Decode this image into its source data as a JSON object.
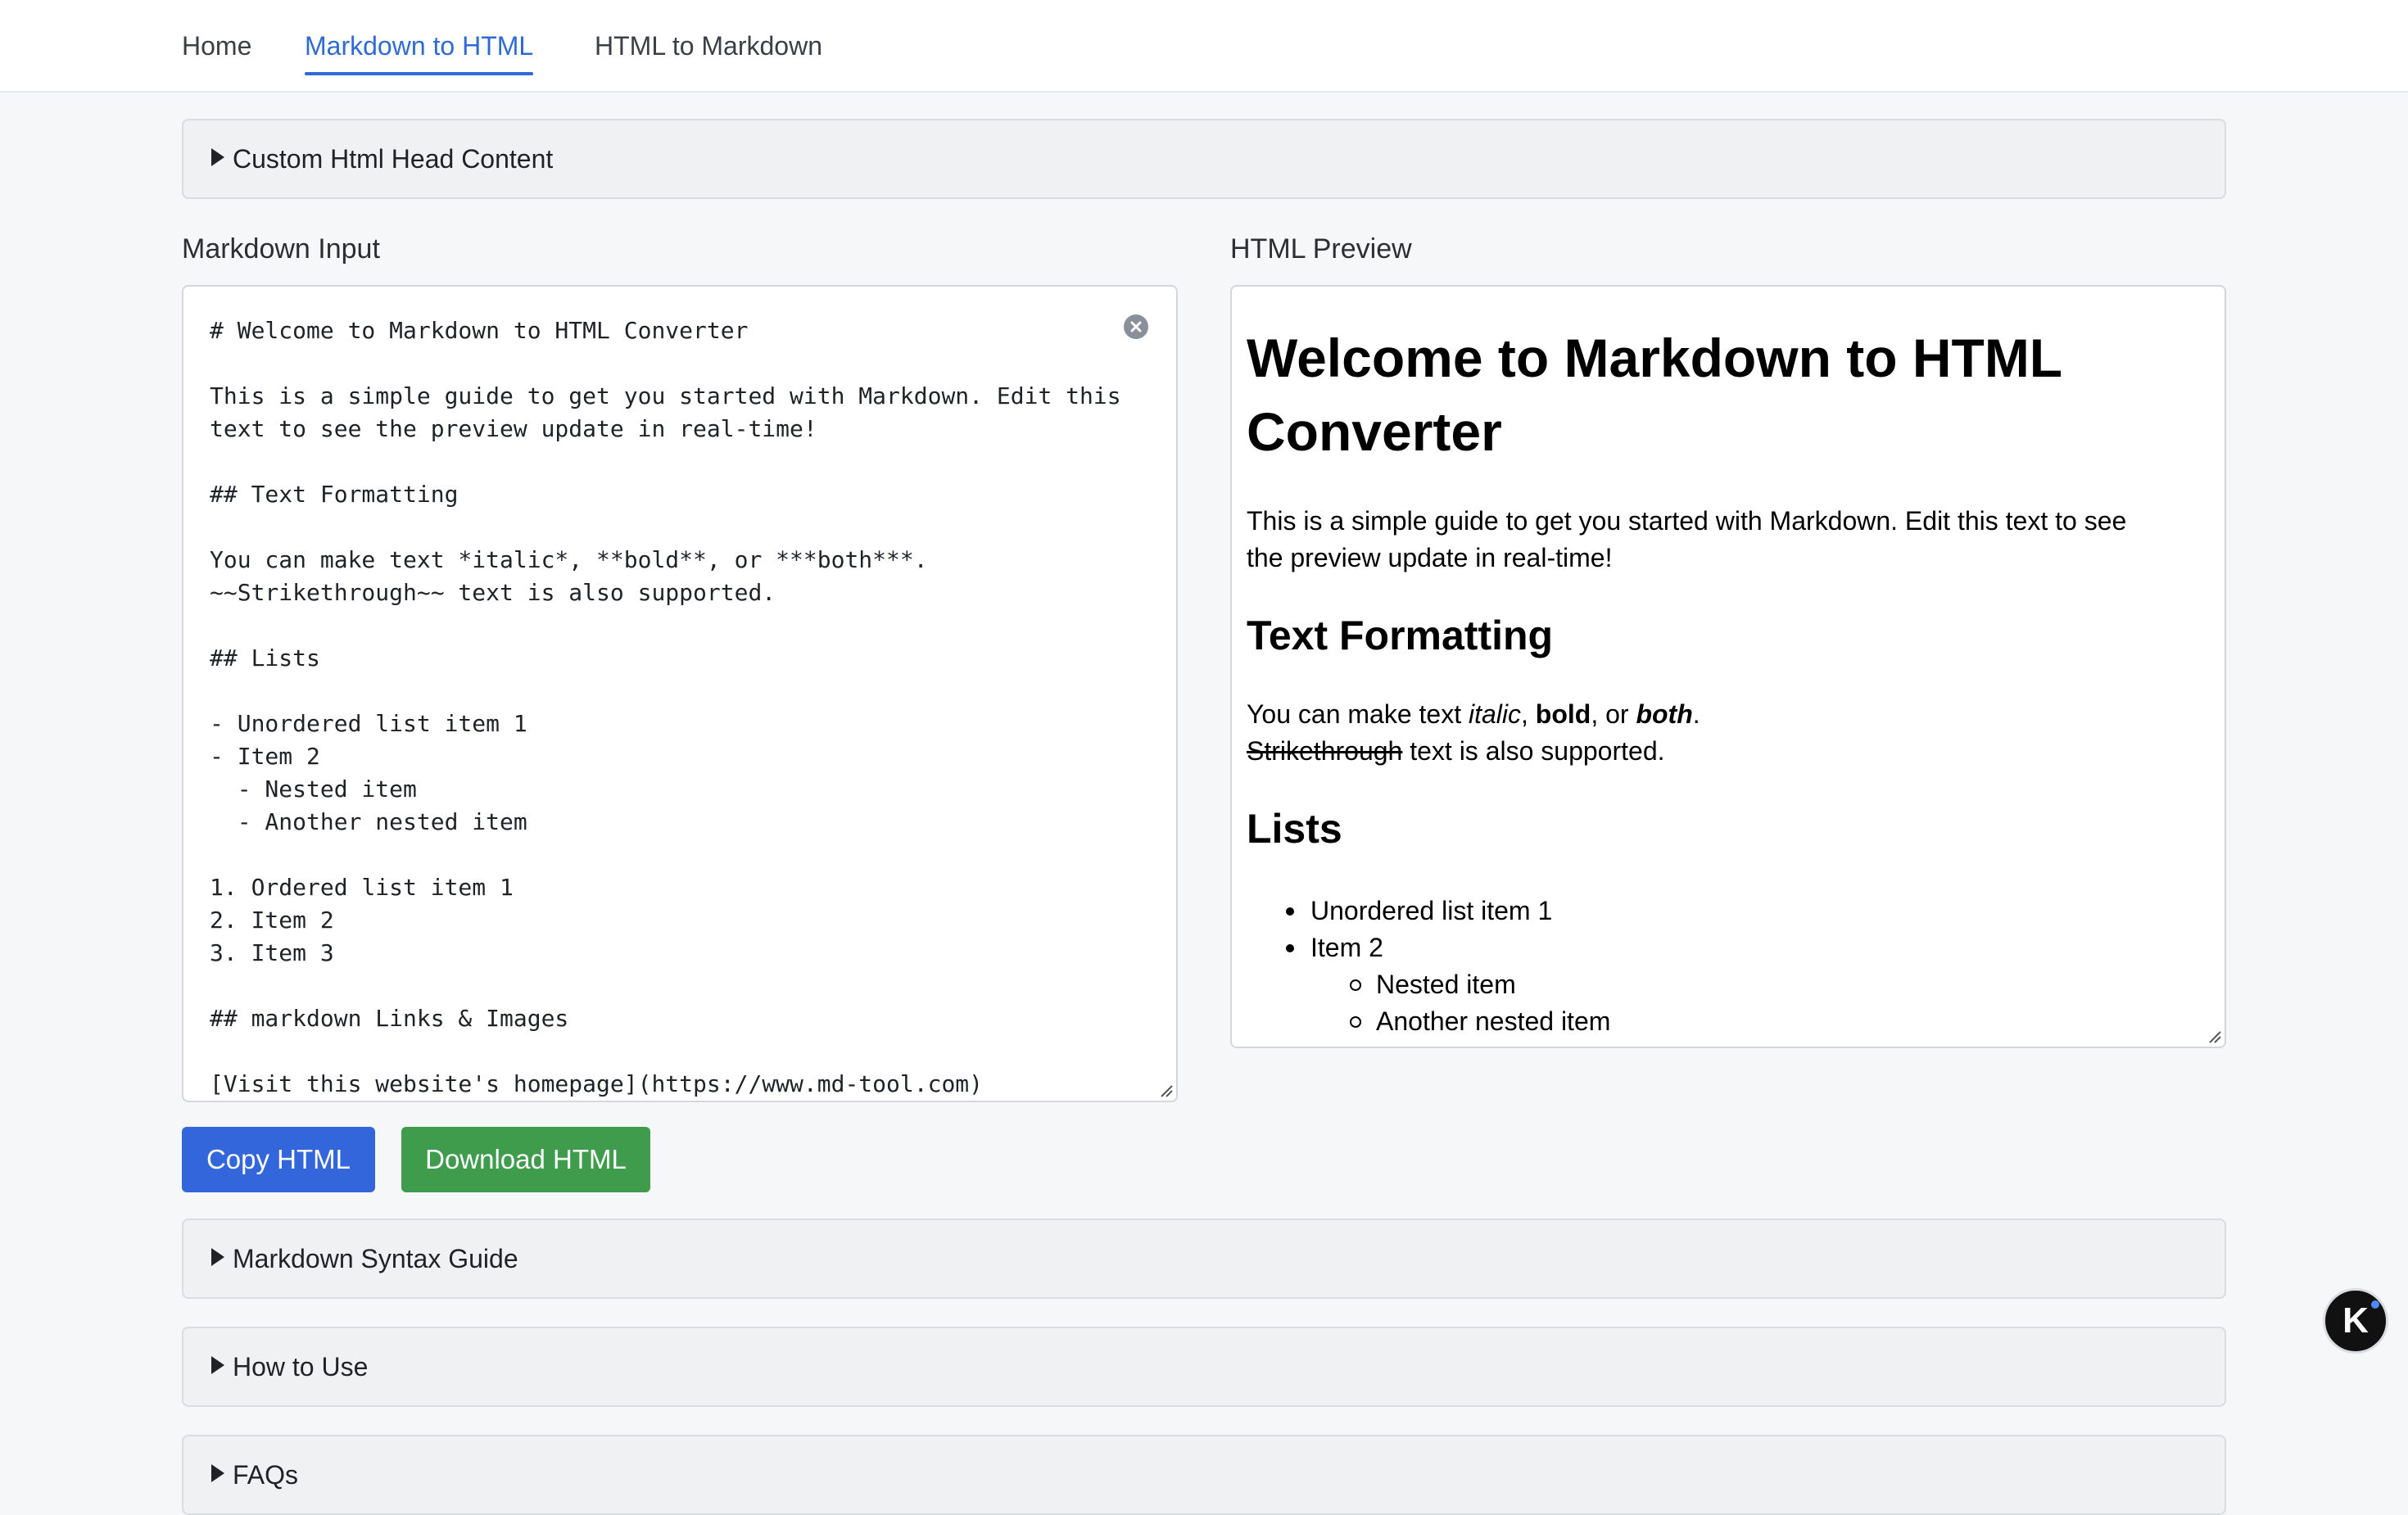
{
  "nav": {
    "items": [
      {
        "label": "Home"
      },
      {
        "label": "Markdown to HTML",
        "active": true
      },
      {
        "label": "HTML to Markdown"
      }
    ]
  },
  "sections": {
    "custom_head": "Custom Html Head Content",
    "syntax_guide": "Markdown Syntax Guide",
    "how_to_use": "How to Use",
    "faqs": "FAQs"
  },
  "editor": {
    "title": "Markdown Input",
    "content": "# Welcome to Markdown to HTML Converter\n\nThis is a simple guide to get you started with Markdown. Edit this\ntext to see the preview update in real-time!\n\n## Text Formatting\n\nYou can make text *italic*, **bold**, or ***both***.\n~~Strikethrough~~ text is also supported.\n\n## Lists\n\n- Unordered list item 1\n- Item 2\n  - Nested item\n  - Another nested item\n\n1. Ordered list item 1\n2. Item 2\n3. Item 3\n\n## markdown Links & Images\n\n[Visit this website's homepage](https://www.md-tool.com)"
  },
  "preview": {
    "title": "HTML Preview",
    "h1_line1": "Welcome to Markdown to HTML",
    "h1_line2": "Converter",
    "intro_line1": "This is a simple guide to get you started with Markdown. Edit this text to see",
    "intro_line2": "the preview update in real-time!",
    "h2_formatting": "Text Formatting",
    "fmt_prefix": "You can make text ",
    "fmt_italic": "italic",
    "fmt_sep1": ", ",
    "fmt_bold": "bold",
    "fmt_sep2": ", or ",
    "fmt_both": "both",
    "fmt_end": ".",
    "strike_text": "Strikethrough",
    "strike_rest": " text is also supported.",
    "h2_lists": "Lists",
    "list_items": [
      "Unordered list item 1",
      "Item 2"
    ],
    "nested_items": [
      "Nested item",
      "Another nested item"
    ]
  },
  "buttons": {
    "copy": "Copy HTML",
    "download": "Download HTML"
  },
  "widget": {
    "letter": "K"
  },
  "colors": {
    "accent": "#2f6bd8",
    "copy_button": "#3366db",
    "download_button": "#3e9c4c"
  }
}
